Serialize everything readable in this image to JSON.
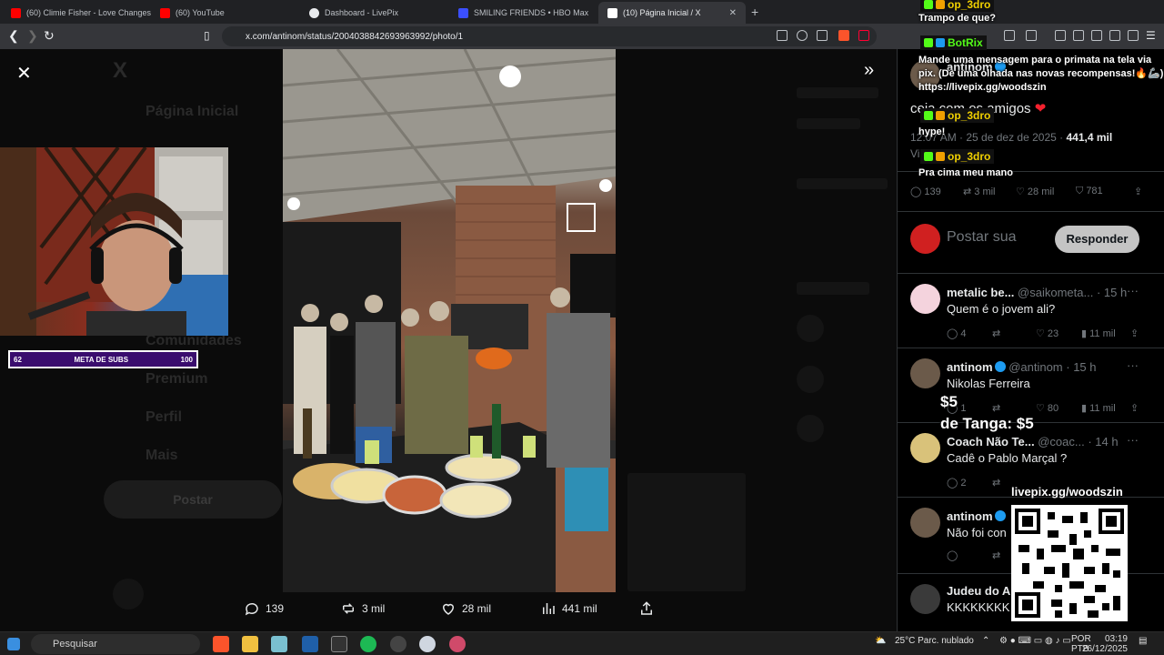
{
  "tabs": [
    {
      "title": "(60) Climie Fisher - Love Changes Ev...",
      "favicon_color": "#ff0000"
    },
    {
      "title": "(60) YouTube",
      "favicon_color": "#ff0000"
    },
    {
      "title": "Dashboard - LivePix",
      "favicon_color": "#e8eaed"
    },
    {
      "title": "SMILING FRIENDS • HBO Max",
      "favicon_color": "#3b4fff"
    },
    {
      "title": "(10) Página Inicial / X",
      "favicon_color": "#ffffff"
    }
  ],
  "url": "x.com/antinom/status/2004038842693963992/photo/1",
  "background_nav": {
    "items": [
      "Página Inicial",
      "Comunidades",
      "Premium",
      "Perfil",
      "Mais"
    ],
    "post_button": "Postar"
  },
  "overlay": {
    "subs_goal": {
      "current": "62",
      "label": "META DE SUBS",
      "target": "100"
    }
  },
  "photo_actions": {
    "replies": "139",
    "reposts": "3 mil",
    "likes": "28 mil",
    "views": "441 mil"
  },
  "main_tweet": {
    "author": "antinom",
    "text": "ceia com os amigos",
    "timestamp": "12:07 AM · 25 de dez de 2025 ·",
    "views": "441,4 mil",
    "views_label": "Vis",
    "replies": "139",
    "reposts": "3 mil",
    "likes": "28 mil",
    "bookmarks": "781"
  },
  "reply_box": {
    "placeholder": "Postar sua",
    "button": "Responder"
  },
  "replies": [
    {
      "name": "metalic be...",
      "handle": "@saikometa...",
      "time": "· 15 h",
      "text": "Quem é o jovem ali?",
      "replies": "4",
      "likes": "23",
      "views": "11 mil",
      "avatar_color": "#f4d3dd"
    },
    {
      "name": "antinom",
      "handle": "@antinom",
      "time": "· 15 h",
      "text": "Nikolas Ferreira",
      "replies": "1",
      "likes": "80",
      "views": "11 mil",
      "avatar_color": "#6b5a4a"
    },
    {
      "name": "Coach Não Te...",
      "handle": "@coac...",
      "time": "· 14 h",
      "text": "Cadê o Pablo Marçal ?",
      "replies": "2",
      "likes": "",
      "views": "",
      "avatar_color": "#d9c27a"
    },
    {
      "name": "antinom",
      "handle": "",
      "time": "",
      "text": "Não foi con",
      "replies": "",
      "likes": "",
      "views": "",
      "avatar_color": "#6b5a4a"
    },
    {
      "name": "Judeu do A",
      "handle": "",
      "time": "",
      "text": "KKKKKKKK",
      "replies": "",
      "likes": "",
      "views": "",
      "avatar_color": "#3a3a3a"
    }
  ],
  "chat": [
    {
      "user": "op_3dro",
      "message": "Trampo de que?"
    },
    {
      "user": "BotRix",
      "message": "Mande uma mensagem para o primata na tela via pix. (De uma olhada nas novas recompensas!🔥🦾) https://livepix.gg/woodszin"
    },
    {
      "user": "op_3dro",
      "message": "hype!"
    },
    {
      "user": "op_3dro",
      "message": "Pra cima meu mano"
    }
  ],
  "donations": [
    "$5",
    "de Tanga: $5"
  ],
  "qr_label": "livepix.gg/woodszin",
  "taskbar": {
    "search": "Pesquisar",
    "weather": "25°C  Parc. nublado",
    "lang1": "POR",
    "lang2": "PTB",
    "time": "03:19",
    "date": "26/12/2025"
  }
}
